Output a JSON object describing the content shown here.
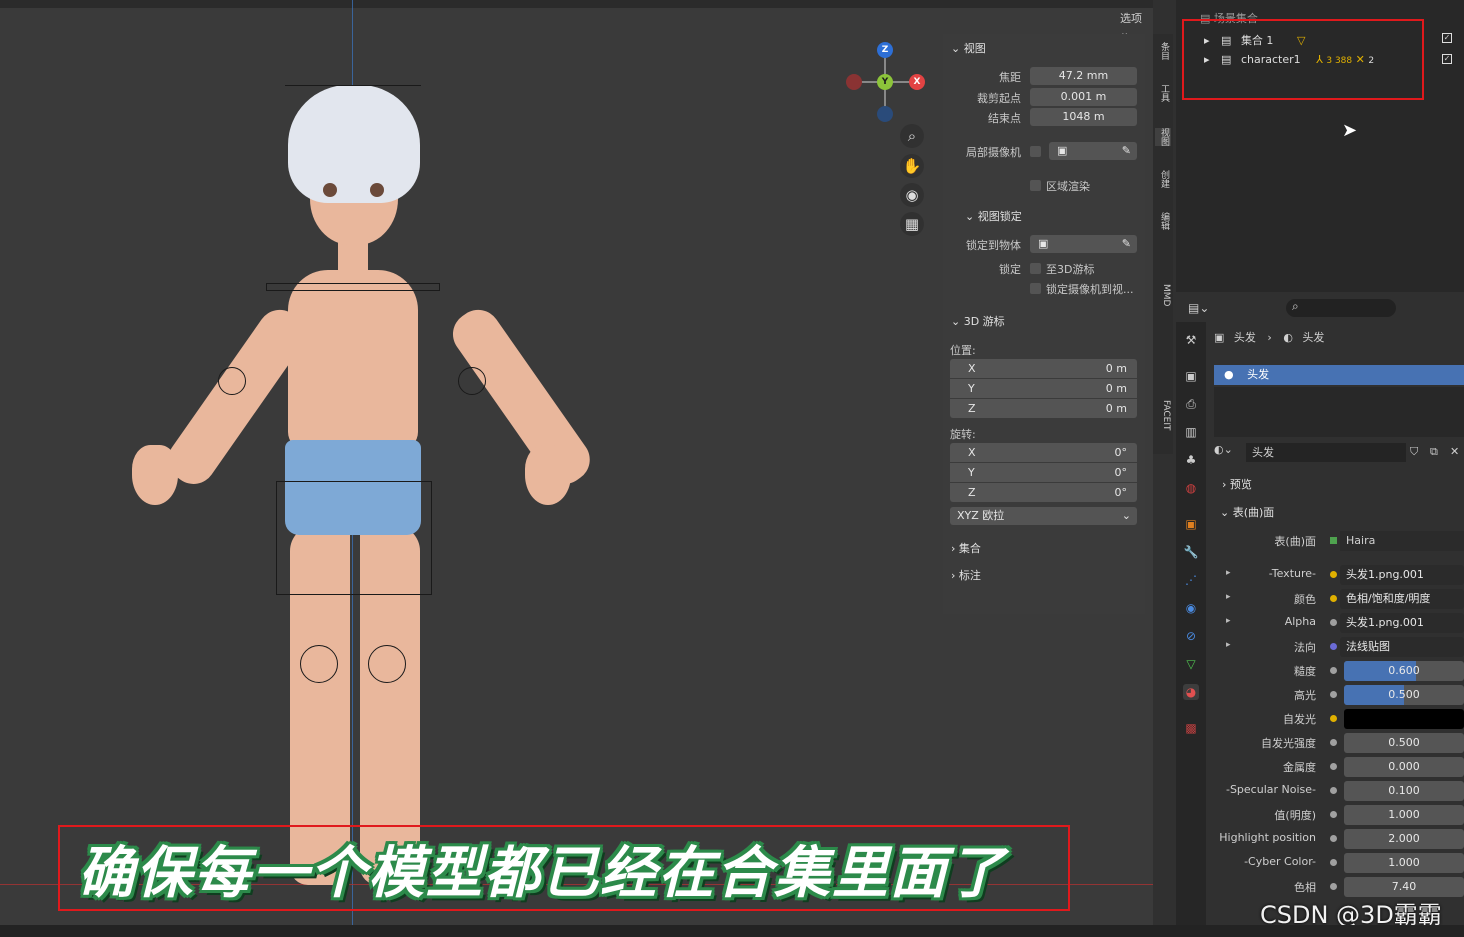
{
  "viewport": {
    "options_label": "选项",
    "gizmo": {
      "z": "Z",
      "y": "Y",
      "x": "X"
    },
    "nav_icons": [
      "zoom-icon",
      "hand-pan-icon",
      "camera-icon",
      "grid-icon"
    ]
  },
  "npanel": {
    "view_header": "视图",
    "focal_label": "焦距",
    "focal_value": "47.2 mm",
    "clip_start_label": "裁剪起点",
    "clip_start_value": "0.001 m",
    "clip_end_label": "结束点",
    "clip_end_value": "1048 m",
    "local_camera_label": "局部摄像机",
    "region_render_label": "区域渲染",
    "view_lock_header": "视图锁定",
    "lock_to_object_label": "锁定到物体",
    "lock_label": "锁定",
    "to_3d_cursor_label": "至3D游标",
    "lock_camera_label": "锁定摄像机到视...",
    "cursor_header": "3D 游标",
    "location_label": "位置:",
    "location": [
      {
        "axis": "X",
        "value": "0 m"
      },
      {
        "axis": "Y",
        "value": "0 m"
      },
      {
        "axis": "Z",
        "value": "0 m"
      }
    ],
    "rotation_label": "旋转:",
    "rotation": [
      {
        "axis": "X",
        "value": "0°"
      },
      {
        "axis": "Y",
        "value": "0°"
      },
      {
        "axis": "Z",
        "value": "0°"
      }
    ],
    "rotation_mode": "XYZ 欧拉",
    "collection_header": "集合",
    "annotation_header": "标注"
  },
  "vtabs": [
    "条目",
    "工具",
    "视图",
    "创建",
    "编辑",
    "MMD",
    "FACEIT"
  ],
  "outliner": {
    "root_label": "场景集合",
    "rows": [
      {
        "label": "集合 1"
      },
      {
        "label": "character1",
        "badge": "3 388",
        "badge2": "2"
      }
    ]
  },
  "properties": {
    "breadcrumb_object": "头发",
    "breadcrumb_material": "头发",
    "slot_name": "头发",
    "material_name": "头发",
    "preview_header": "预览",
    "surface_header": "表(曲)面",
    "surface_label": "表(曲)面",
    "surface_value": "Haira",
    "rows": [
      {
        "label": "-Texture-",
        "value": "头发1.png.001",
        "dot": "#e0b000",
        "arrow": true,
        "type": "link"
      },
      {
        "label": "颜色",
        "value": "色相/饱和度/明度",
        "dot": "#e0b000",
        "arrow": true,
        "type": "link"
      },
      {
        "label": "Alpha",
        "value": "头发1.png.001",
        "dot": "#a0a0a0",
        "arrow": true,
        "type": "link"
      },
      {
        "label": "法向",
        "value": "法线贴图",
        "dot": "#6b6bd6",
        "arrow": true,
        "type": "link"
      },
      {
        "label": "糙度",
        "value": "0.600",
        "dot": "#a0a0a0",
        "fill": 0.6,
        "type": "bar"
      },
      {
        "label": "高光",
        "value": "0.500",
        "dot": "#a0a0a0",
        "fill": 0.5,
        "type": "bar"
      },
      {
        "label": "自发光",
        "value": "",
        "dot": "#e0b000",
        "type": "color"
      },
      {
        "label": "自发光强度",
        "value": "0.500",
        "dot": "#a0a0a0",
        "type": "num"
      },
      {
        "label": "金属度",
        "value": "0.000",
        "dot": "#a0a0a0",
        "type": "num"
      },
      {
        "label": "-Specular Noise-",
        "value": "0.100",
        "dot": "#a0a0a0",
        "type": "num"
      },
      {
        "label": "值(明度)",
        "value": "1.000",
        "dot": "#a0a0a0",
        "type": "num"
      },
      {
        "label": "Highlight position",
        "value": "2.000",
        "dot": "#a0a0a0",
        "type": "num"
      },
      {
        "label": "-Cyber Color-",
        "value": "1.000",
        "dot": "#a0a0a0",
        "type": "num"
      },
      {
        "label": "色相",
        "value": "7.40",
        "dot": "#a0a0a0",
        "type": "num"
      }
    ]
  },
  "subtitle": "确保每一个模型都已经在合集里面了",
  "watermark": "CSDN @3D霸霸"
}
